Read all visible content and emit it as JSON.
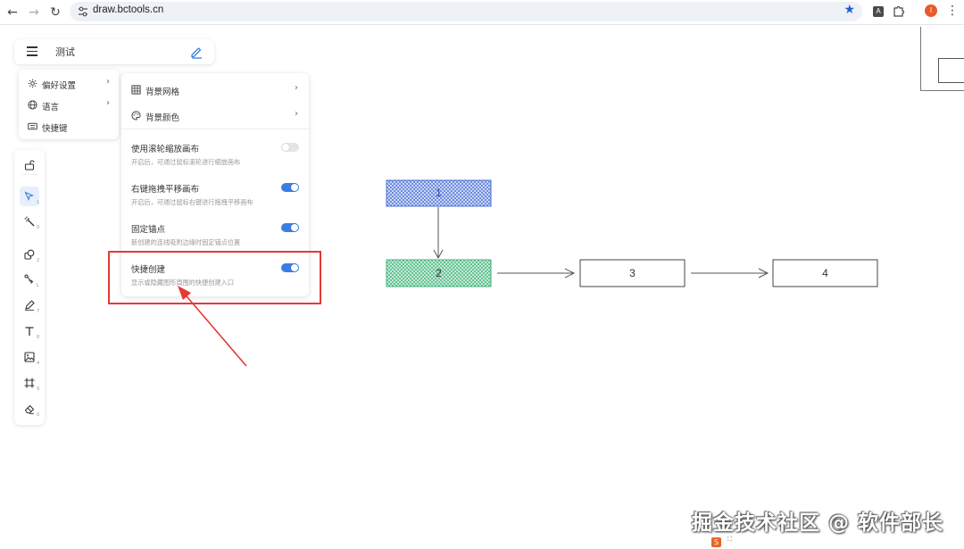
{
  "browser": {
    "url": "draw.bctools.cn",
    "back_icon": "←",
    "forward_icon": "→",
    "reload_icon": "↻",
    "star_icon": "★",
    "ext_label": "A",
    "profile_initial": "I",
    "menu_icon": "⋮"
  },
  "header": {
    "title": "测试"
  },
  "main_menu": {
    "items": [
      {
        "label": "偏好设置",
        "icon": "gear-icon",
        "arrow": "›"
      },
      {
        "label": "语言",
        "icon": "globe-icon",
        "arrow": "›"
      },
      {
        "label": "快捷键",
        "icon": "keyboard-icon",
        "arrow": ""
      }
    ]
  },
  "preferences": {
    "rows": [
      {
        "label": "背景网格",
        "icon": "grid-icon",
        "arrow": "›"
      },
      {
        "label": "背景颜色",
        "icon": "palette-icon",
        "arrow": "›"
      }
    ],
    "options": [
      {
        "title": "使用滚轮缩放画布",
        "desc": "开启后，可通过鼠标滚轮进行缩放画布",
        "enabled": false
      },
      {
        "title": "右键拖拽平移画布",
        "desc": "开启后，可通过鼠标右键进行拖拽平移画布",
        "enabled": true
      },
      {
        "title": "固定锚点",
        "desc": "新创建的连线吸附边缘时固定锚点位置",
        "enabled": true
      },
      {
        "title": "快捷创建",
        "desc": "显示或隐藏图形周围的快捷创建入口",
        "enabled": true
      }
    ]
  },
  "toolbar": {
    "tools": [
      {
        "name": "lock",
        "key": ""
      },
      {
        "name": "select",
        "key": "1"
      },
      {
        "name": "magic",
        "key": "0"
      },
      {
        "name": "shape",
        "key": "2"
      },
      {
        "name": "connector",
        "key": "L"
      },
      {
        "name": "pen",
        "key": "7"
      },
      {
        "name": "text",
        "key": "8"
      },
      {
        "name": "image",
        "key": "4"
      },
      {
        "name": "frame",
        "key": "9"
      },
      {
        "name": "eraser",
        "key": "0"
      }
    ]
  },
  "diagram": {
    "nodes": [
      {
        "label": "1",
        "style": "hatch-blue"
      },
      {
        "label": "2",
        "style": "hatch-green"
      },
      {
        "label": "3",
        "style": "plain"
      },
      {
        "label": "4",
        "style": "plain"
      }
    ]
  },
  "watermark": {
    "text": "掘金技术社区 @ 软件部长"
  },
  "colors": {
    "accent": "#3a7ee3",
    "highlight": "#e53935",
    "node1_hatch": "#4a6fd8",
    "node2_hatch": "#3fb37a"
  }
}
